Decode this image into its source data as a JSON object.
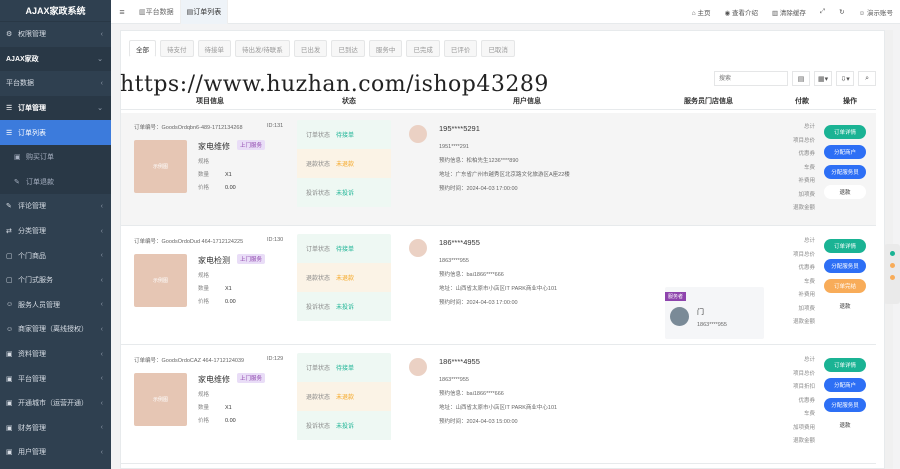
{
  "sidebar": {
    "title": "AJAX家政系统",
    "items": [
      {
        "icon": "gear-icon",
        "label": "权限管理",
        "kind": "group"
      },
      {
        "icon": "",
        "label": "AJAX家政",
        "kind": "open"
      },
      {
        "icon": "",
        "label": "平台数据",
        "kind": "group"
      },
      {
        "icon": "list-icon",
        "label": "订单管理",
        "kind": "open"
      },
      {
        "icon": "list-icon",
        "label": "订单列表",
        "kind": "active"
      },
      {
        "icon": "cart-icon",
        "label": "购买订单",
        "kind": "sub"
      },
      {
        "icon": "wrench-icon",
        "label": "订单退款",
        "kind": "sub"
      },
      {
        "icon": "edit-icon",
        "label": "评论管理",
        "kind": "group"
      },
      {
        "icon": "share-icon",
        "label": "分类管理",
        "kind": "group"
      },
      {
        "icon": "box-icon",
        "label": "个门商品",
        "kind": "group"
      },
      {
        "icon": "box-icon",
        "label": "个门式服务",
        "kind": "group"
      },
      {
        "icon": "users-icon",
        "label": "服务人员管理",
        "kind": "group"
      },
      {
        "icon": "users-icon",
        "label": "商家管理（离线授权）",
        "kind": "group"
      },
      {
        "icon": "file-icon",
        "label": "资料管理",
        "kind": "group"
      },
      {
        "icon": "file-icon",
        "label": "平台管理",
        "kind": "group"
      },
      {
        "icon": "file-icon",
        "label": "开通城市（运营开通）",
        "kind": "group"
      },
      {
        "icon": "file-icon",
        "label": "财务管理",
        "kind": "group"
      },
      {
        "icon": "file-icon",
        "label": "用户管理",
        "kind": "group"
      }
    ]
  },
  "topbar": {
    "menu_icon": "≡",
    "tabs": [
      {
        "label": "平台数据",
        "active": false
      },
      {
        "label": "订单列表",
        "active": true
      }
    ],
    "right": [
      {
        "icon": "home-icon",
        "label": "主页"
      },
      {
        "icon": "eye-icon",
        "label": "查看介绍"
      },
      {
        "icon": "trash-icon",
        "label": "清除缓存"
      },
      {
        "icon": "expand-icon",
        "label": ""
      },
      {
        "icon": "refresh-icon",
        "label": ""
      },
      {
        "icon": "user-icon",
        "label": "演示账号"
      }
    ]
  },
  "status_tabs": [
    "全部",
    "待支付",
    "待接单",
    "待出发/待联系",
    "已出发",
    "已到达",
    "服务中",
    "已完成",
    "已评价",
    "已取消"
  ],
  "search": {
    "placeholder": "搜索"
  },
  "table": {
    "headers": [
      "项目信息",
      "状态",
      "用户信息",
      "服务员门店信息",
      "付款",
      "操作"
    ],
    "rows": [
      {
        "order_no": "订单编号：GoodsOrdqbn6-489-1712134268",
        "id": "ID:131",
        "thumb": "示例图",
        "name": "家电维修",
        "tag": "上门服务",
        "spec_label": "规格",
        "spec": "",
        "qty_label": "数量",
        "qty": "X1",
        "price_label": "价格",
        "price": "0.00",
        "status": [
          {
            "label": "订单状态",
            "value": "待接单",
            "color": "green"
          },
          {
            "label": "退款状态",
            "value": "未退款",
            "color": "orange"
          },
          {
            "label": "投诉状态",
            "value": "未投诉",
            "color": "green"
          }
        ],
        "phone": "195****5291",
        "lines": [
          "1951****291",
          "预约信息：松柏先生1236****890",
          "地址：广东省广州市越秀区北京路文化旅游区A座22楼",
          "预约时间：2024-04-03 17:00:00"
        ],
        "provider": null,
        "fee": [
          "总计",
          "项目总价",
          "优惠券",
          "车费",
          "补费用",
          "加项费",
          "退款金额"
        ],
        "buttons": [
          {
            "label": "订单详情",
            "c": "bg"
          },
          {
            "label": "分配商户",
            "c": "bb"
          },
          {
            "label": "分配服务员",
            "c": "bb"
          },
          {
            "label": "退款",
            "c": "bw"
          }
        ]
      },
      {
        "order_no": "订单编号：GoodsOrdoDud 464-1712124225",
        "id": "ID:130",
        "thumb": "示例图",
        "name": "家电检测",
        "tag": "上门服务",
        "spec_label": "规格",
        "spec": "",
        "qty_label": "数量",
        "qty": "X1",
        "price_label": "价格",
        "price": "0.00",
        "status": [
          {
            "label": "订单状态",
            "value": "待接单",
            "color": "green"
          },
          {
            "label": "退款状态",
            "value": "未退款",
            "color": "orange"
          },
          {
            "label": "投诉状态",
            "value": "未投诉",
            "color": "green"
          }
        ],
        "phone": "186****4955",
        "lines": [
          "1863****955",
          "预约信息：bai1866****666",
          "地址：山西省太原市小店区IT PARK商业中心101",
          "预约时间：2024-04-03 17:00:00"
        ],
        "provider": {
          "tag": "服务者",
          "name": "门",
          "phone": "1863****955"
        },
        "fee": [
          "总计",
          "项目总价",
          "优惠券",
          "车费",
          "补费用",
          "加项费",
          "退款金额"
        ],
        "buttons": [
          {
            "label": "订单详情",
            "c": "bg"
          },
          {
            "label": "分配服务员",
            "c": "bb"
          },
          {
            "label": "订单完结",
            "c": "bo"
          },
          {
            "label": "退款",
            "c": "bw"
          }
        ]
      },
      {
        "order_no": "订单编号：GoodsOrdoCAZ 464-1712124039",
        "id": "ID:129",
        "thumb": "示例图",
        "name": "家电维修",
        "tag": "上门服务",
        "spec_label": "规格",
        "spec": "",
        "qty_label": "数量",
        "qty": "X1",
        "price_label": "价格",
        "price": "0.00",
        "status": [
          {
            "label": "订单状态",
            "value": "待接单",
            "color": "green"
          },
          {
            "label": "退款状态",
            "value": "未退款",
            "color": "orange"
          },
          {
            "label": "投诉状态",
            "value": "未投诉",
            "color": "green"
          }
        ],
        "phone": "186****4955",
        "lines": [
          "1863****955",
          "预约信息：bai1866****666",
          "地址：山西省太原市小店区IT PARK商业中心101",
          "预约时间：2024-04-03 15:00:00"
        ],
        "provider": null,
        "fee": [
          "总计",
          "项目总价",
          "项目折扣",
          "优惠券",
          "车费",
          "加项费用",
          "退款金额"
        ],
        "buttons": [
          {
            "label": "订单详情",
            "c": "bg"
          },
          {
            "label": "分配商户",
            "c": "bb"
          },
          {
            "label": "分配服务员",
            "c": "bb"
          },
          {
            "label": "退款",
            "c": "bw"
          }
        ]
      }
    ]
  },
  "watermark": "https://www.huzhan.com/ishop43289",
  "colors": {
    "sidebar": "#2f4050",
    "active": "#3c7bdc",
    "green": "#1ab394",
    "blue": "#2d6ff5",
    "orange": "#f8ac59"
  }
}
